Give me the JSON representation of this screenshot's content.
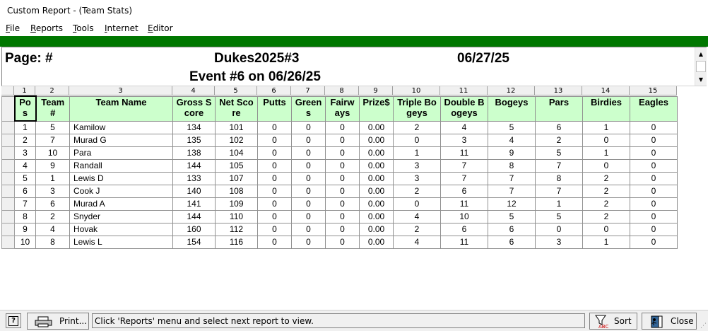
{
  "window": {
    "title": "Custom Report - (Team Stats)"
  },
  "menu": [
    {
      "label": "File",
      "u": "F",
      "rest": "ile"
    },
    {
      "label": "Reports",
      "u": "R",
      "rest": "eports"
    },
    {
      "label": "Tools",
      "u": "T",
      "rest": "ools"
    },
    {
      "label": "Internet",
      "u": "I",
      "rest": "nternet"
    },
    {
      "label": "Editor",
      "u": "E",
      "rest": "ditor"
    }
  ],
  "header": {
    "page": "Page: #",
    "league": "Dukes2025#3",
    "date": "06/27/25",
    "event": "Event #6 on 06/26/25"
  },
  "column_numbers": [
    "1",
    "2",
    "3",
    "4",
    "5",
    "6",
    "7",
    "8",
    "9",
    "10",
    "11",
    "12",
    "13",
    "14",
    "15"
  ],
  "table": {
    "headers": [
      "Pos",
      "Team #",
      "Team Name",
      "Gross Score",
      "Net Score",
      "Putts",
      "Greens",
      "Fairways",
      "Prize$",
      "Triple Bogeys",
      "Double Bogeys",
      "Bogeys",
      "Pars",
      "Birdies",
      "Eagles"
    ],
    "rows": [
      [
        "1",
        "5",
        "Kamilow",
        "134",
        "101",
        "0",
        "0",
        "0",
        "0.00",
        "2",
        "4",
        "5",
        "6",
        "1",
        "0"
      ],
      [
        "2",
        "7",
        "Murad G",
        "135",
        "102",
        "0",
        "0",
        "0",
        "0.00",
        "0",
        "3",
        "4",
        "2",
        "0",
        "0"
      ],
      [
        "3",
        "10",
        "Para",
        "138",
        "104",
        "0",
        "0",
        "0",
        "0.00",
        "1",
        "11",
        "9",
        "5",
        "1",
        "0"
      ],
      [
        "4",
        "9",
        "Randall",
        "144",
        "105",
        "0",
        "0",
        "0",
        "0.00",
        "3",
        "7",
        "8",
        "7",
        "0",
        "0"
      ],
      [
        "5",
        "1",
        "Lewis D",
        "133",
        "107",
        "0",
        "0",
        "0",
        "0.00",
        "3",
        "7",
        "7",
        "8",
        "2",
        "0"
      ],
      [
        "6",
        "3",
        "Cook J",
        "140",
        "108",
        "0",
        "0",
        "0",
        "0.00",
        "2",
        "6",
        "7",
        "7",
        "2",
        "0"
      ],
      [
        "7",
        "6",
        "Murad A",
        "141",
        "109",
        "0",
        "0",
        "0",
        "0.00",
        "0",
        "11",
        "12",
        "1",
        "2",
        "0"
      ],
      [
        "8",
        "2",
        "Snyder",
        "144",
        "110",
        "0",
        "0",
        "0",
        "0.00",
        "4",
        "10",
        "5",
        "5",
        "2",
        "0"
      ],
      [
        "9",
        "4",
        "Hovak",
        "160",
        "112",
        "0",
        "0",
        "0",
        "0.00",
        "2",
        "6",
        "6",
        "0",
        "0",
        "0"
      ],
      [
        "10",
        "8",
        "Lewis L",
        "154",
        "116",
        "0",
        "0",
        "0",
        "0.00",
        "4",
        "11",
        "6",
        "3",
        "1",
        "0"
      ]
    ]
  },
  "status": {
    "help_label": "?",
    "print_label": "Print...",
    "message": "Click 'Reports' menu and select next report to view.",
    "sort_label": "Sort",
    "close_label": "Close"
  },
  "icons": {
    "help": "help-icon",
    "print": "printer-icon",
    "sort": "funnel-sort-icon",
    "close": "exit-door-icon"
  },
  "colors": {
    "green_bar": "#007700",
    "header_fill": "#ccffcc"
  }
}
